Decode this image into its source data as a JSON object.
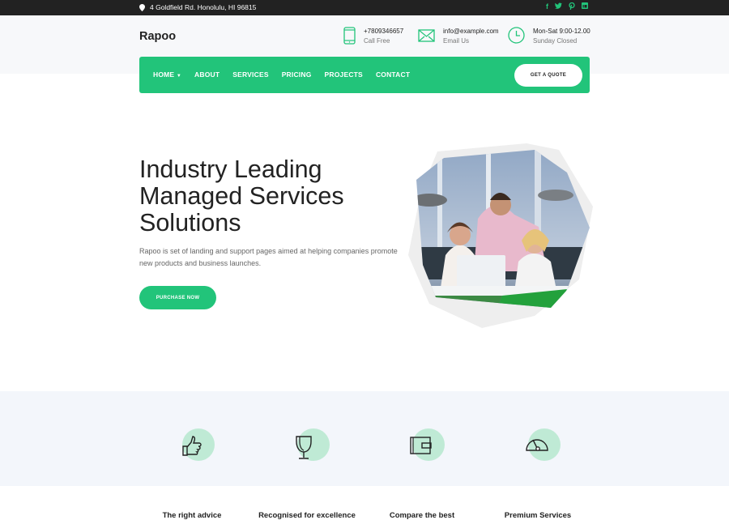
{
  "topbar": {
    "address": "4 Goldfield Rd. Honolulu, HI 96815",
    "social": [
      "facebook",
      "twitter",
      "pinterest",
      "linkedin"
    ]
  },
  "header": {
    "logo": "Rapoo",
    "contacts": [
      {
        "icon": "phone-icon",
        "line1": "+7809346657",
        "line2": "Call Free"
      },
      {
        "icon": "mail-icon",
        "line1": "info@example.com",
        "line2": "Email Us"
      },
      {
        "icon": "clock-icon",
        "line1": "Mon-Sat 9:00-12.00",
        "line2": "Sunday Closed"
      }
    ]
  },
  "nav": {
    "items": [
      {
        "label": "HOME",
        "dropdown": true
      },
      {
        "label": "ABOUT"
      },
      {
        "label": "SERVICES"
      },
      {
        "label": "PRICING"
      },
      {
        "label": "PROJECTS"
      },
      {
        "label": "CONTACT"
      }
    ],
    "cta": "GET A QUOTE"
  },
  "hero": {
    "title_line1": "Industry Leading",
    "title_line2": "Managed Services",
    "title_line3": "Solutions",
    "description": "Rapoo is set of landing and support pages aimed at helping companies promote new products and business launches.",
    "button": "PURCHASE NOW",
    "image_alt": "team working at laptop"
  },
  "features": [
    {
      "icon": "thumbs-up-icon",
      "label": "The right advice"
    },
    {
      "icon": "trophy-icon",
      "label": "Recognised for excellence"
    },
    {
      "icon": "wallet-icon",
      "label": "Compare the best"
    },
    {
      "icon": "speedometer-icon",
      "label": "Premium Services"
    }
  ],
  "colors": {
    "accent": "#22c47a",
    "topbar": "#222222",
    "light_bg": "#f3f6fb"
  }
}
